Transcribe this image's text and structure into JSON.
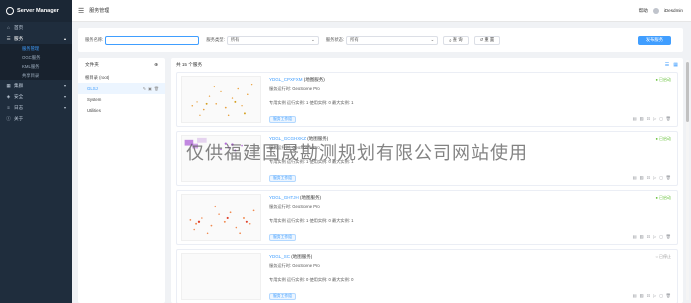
{
  "app": {
    "logo_text": "Server Manager",
    "page_title": "服务管理"
  },
  "topbar": {
    "help": "帮助",
    "user": "iDesdmin"
  },
  "sidebar": {
    "items": [
      {
        "label": "首页",
        "icon": "home-icon"
      },
      {
        "label": "服务",
        "icon": "server-icon",
        "open": true,
        "children": [
          {
            "label": "服务管理",
            "active": true
          },
          {
            "label": "OGC服务"
          },
          {
            "label": "KML服务"
          },
          {
            "label": "共享目录"
          }
        ]
      },
      {
        "label": "集群",
        "icon": "cluster-icon"
      },
      {
        "label": "安全",
        "icon": "shield-icon"
      },
      {
        "label": "日志",
        "icon": "log-icon"
      },
      {
        "label": "关于",
        "icon": "info-icon"
      }
    ]
  },
  "filters": {
    "name_label": "服务名称:",
    "name_placeholder": "",
    "type_label": "服务类型:",
    "type_value": "所有",
    "status_label": "服务状态:",
    "status_value": "所有",
    "query_label": "查 询",
    "reset_label": "重 置",
    "publish_label": "发布服务"
  },
  "folders": {
    "title": "文件夹",
    "items": [
      {
        "label": "根目录 (root)"
      },
      {
        "label": "GLSJ",
        "active": true
      },
      {
        "label": "System"
      },
      {
        "label": "Utilities"
      }
    ]
  },
  "services": {
    "total_label": "共 15 个服务",
    "cards": [
      {
        "name": "YDGL_CPXFXM",
        "type": "(地图服务)",
        "engine_label": "服务运行时:",
        "engine": "GeoScene Pro",
        "stats": "专用实例  运行实例: 1  使用实例: 0  最大实例: 1",
        "tag": "服务工作组",
        "status": "● 已启动",
        "status_kind": "running"
      },
      {
        "name": "YDGL_GCGHXKZ",
        "type": "(地图服务)",
        "engine_label": "服务运行时:",
        "engine": "GeoScene Pro",
        "stats": "专用实例  运行实例: 1  使用实例: 0  最大实例: 1",
        "tag": "服务工作组",
        "status": "● 已启动",
        "status_kind": "running"
      },
      {
        "name": "YDGL_GHTJH",
        "type": "(地图服务)",
        "engine_label": "服务运行时:",
        "engine": "GeoScene Pro",
        "stats": "专用实例  运行实例: 1  使用实例: 0  最大实例: 1",
        "tag": "服务工作组",
        "status": "● 已启动",
        "status_kind": "running"
      },
      {
        "name": "YDGL_SC",
        "type": "(地图服务)",
        "engine_label": "服务运行时:",
        "engine": "GeoScene Pro",
        "stats": "专用实例  运行实例: 0  使用实例: 0  最大实例: 0",
        "tag": "服务工作组",
        "status": "○ 已停止",
        "status_kind": "stopped"
      }
    ]
  },
  "watermark": "仅供福建国晟勘测规划有限公司网站使用",
  "colors": {
    "primary": "#409eff",
    "sidebar": "#1f2d3d",
    "running": "#67c23a"
  }
}
